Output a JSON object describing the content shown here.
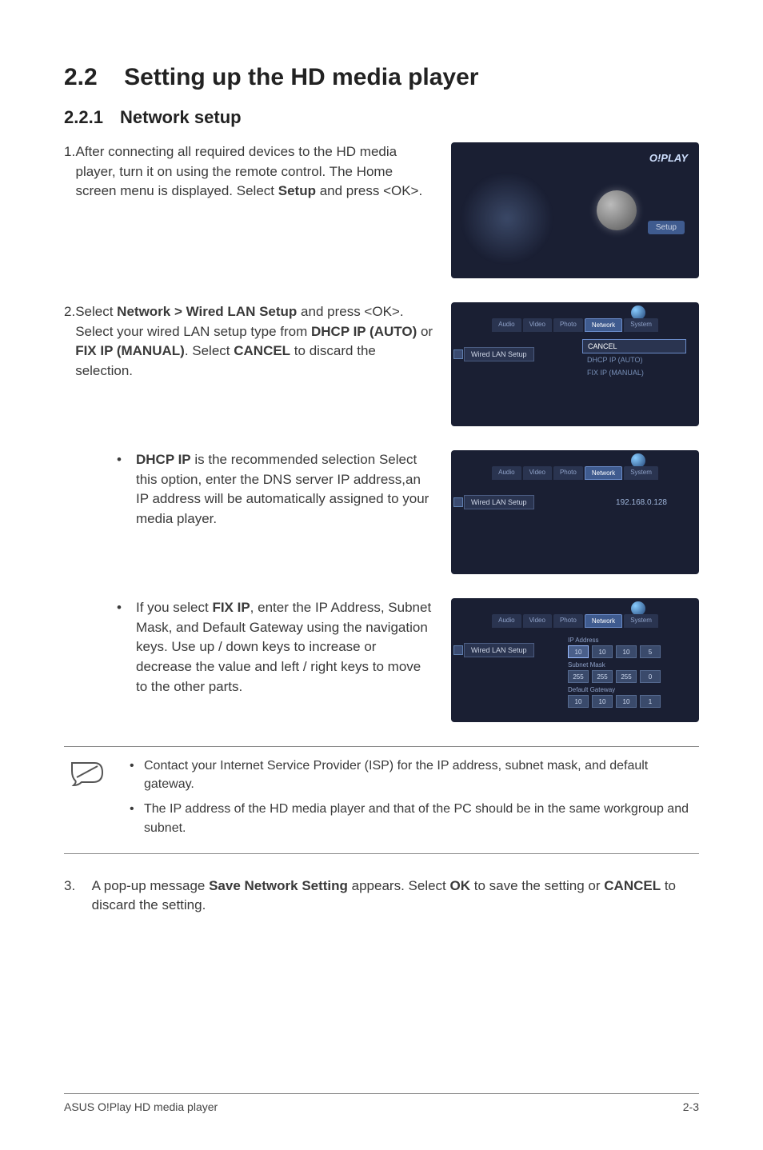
{
  "section": {
    "num": "2.2",
    "title": "Setting up the HD media player"
  },
  "subsection": {
    "num": "2.2.1",
    "title": "Network setup"
  },
  "steps": {
    "s1": {
      "num": "1.",
      "text_pre": "After connecting all required devices to the HD media player, turn it on using the remote control. The Home screen menu is displayed. Select ",
      "b1": "Setup",
      "text_post": " and press <OK>."
    },
    "s2": {
      "num": "2.",
      "t1": "Select ",
      "b1": "Network > Wired LAN Setup",
      "t2": " and press <OK>. Select your wired LAN setup type from ",
      "b2": "DHCP IP (AUTO)",
      "t3": " or ",
      "b3": "FIX IP (MANUAL)",
      "t4": ". Select ",
      "b4": "CANCEL",
      "t5": " to discard the selection."
    },
    "dhcp": {
      "b1": "DHCP IP",
      "t1": " is the recommended selection Select this option, enter the DNS server IP address,an IP address will be automatically assigned to your media player."
    },
    "fixip": {
      "t1": "If you select ",
      "b1": "FIX IP",
      "t2": ", enter the IP Address, Subnet Mask, and Default Gateway using the navigation keys. Use up / down keys to increase or decrease the value and left / right keys to move to the other parts."
    },
    "s3": {
      "num": "3.",
      "t1": "A pop-up message ",
      "b1": "Save Network Setting",
      "t2": " appears. Select ",
      "b2": "OK",
      "t3": " to save the setting or ",
      "b3": "CANCEL",
      "t4": " to discard the setting."
    }
  },
  "notes": {
    "n1": "Contact your Internet Service Provider (ISP) for the IP address, subnet mask, and default gateway.",
    "n2": "The IP address of the HD media player and that of the PC should be in the same workgroup and subnet."
  },
  "shots": {
    "home": {
      "logo": "O!PLAY",
      "setup": "Setup"
    },
    "tabs": {
      "audio": "Audio",
      "video": "Video",
      "photo": "Photo",
      "network": "Network",
      "system": "System"
    },
    "wired": "Wired LAN Setup",
    "opts": {
      "cancel": "CANCEL",
      "dhcp": "DHCP IP (AUTO)",
      "fix": "FIX IP (MANUAL)"
    },
    "ip_shown": "192.168.0.128",
    "fix": {
      "ip_lbl": "IP Address",
      "sm_lbl": "Subnet Mask",
      "gw_lbl": "Default Gateway",
      "ip": [
        "10",
        "10",
        "10",
        "5"
      ],
      "sm": [
        "255",
        "255",
        "255",
        "0"
      ],
      "gw": [
        "10",
        "10",
        "10",
        "1"
      ]
    }
  },
  "footer": {
    "left": "ASUS O!Play HD media player",
    "right": "2-3"
  }
}
